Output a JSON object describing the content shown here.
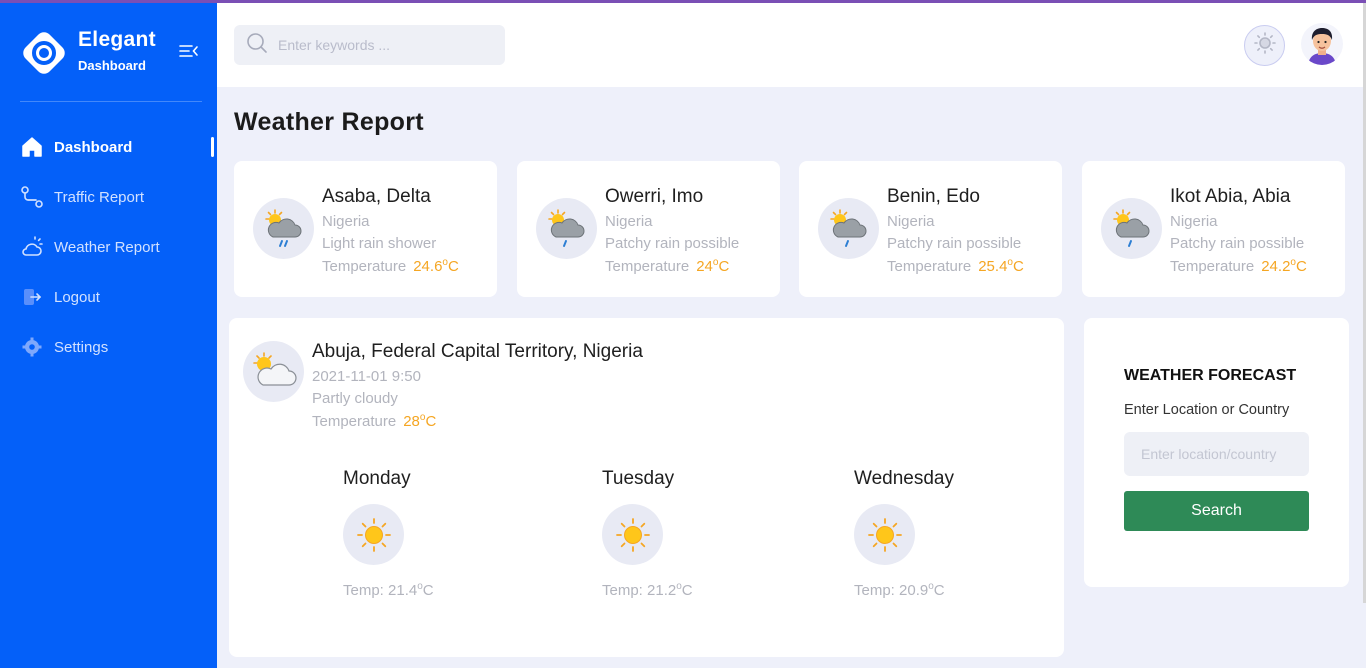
{
  "brand": {
    "name": "Elegant",
    "subtitle": "Dashboard"
  },
  "sidebar": {
    "items": [
      {
        "label": "Dashboard",
        "icon": "home-icon",
        "active": true
      },
      {
        "label": "Traffic Report",
        "icon": "route-icon",
        "active": false
      },
      {
        "label": "Weather Report",
        "icon": "weather-icon",
        "active": false
      },
      {
        "label": "Logout",
        "icon": "logout-icon",
        "active": false
      },
      {
        "label": "Settings",
        "icon": "settings-icon",
        "active": false
      }
    ]
  },
  "header": {
    "search_placeholder": "Enter keywords ..."
  },
  "page": {
    "title": "Weather Report"
  },
  "cities": [
    {
      "name": "Asaba, Delta",
      "country": "Nigeria",
      "condition": "Light rain shower",
      "temp_label": "Temperature",
      "temp": "24.6"
    },
    {
      "name": "Owerri, Imo",
      "country": "Nigeria",
      "condition": "Patchy rain possible",
      "temp_label": "Temperature",
      "temp": "24"
    },
    {
      "name": "Benin, Edo",
      "country": "Nigeria",
      "condition": "Patchy rain possible",
      "temp_label": "Temperature",
      "temp": "25.4"
    },
    {
      "name": "Ikot Abia, Abia",
      "country": "Nigeria",
      "condition": "Patchy rain possible",
      "temp_label": "Temperature",
      "temp": "24.2"
    }
  ],
  "current": {
    "location": "Abuja, Federal Capital Territory, Nigeria",
    "datetime": "2021-11-01 9:50",
    "condition": "Partly cloudy",
    "temp_label": "Temperature",
    "temp": "28"
  },
  "forecast_days": [
    {
      "day": "Monday",
      "temp_prefix": "Temp: ",
      "temp": "21.4"
    },
    {
      "day": "Tuesday",
      "temp_prefix": "Temp: ",
      "temp": "21.2"
    },
    {
      "day": "Wednesday",
      "temp_prefix": "Temp: ",
      "temp": "20.9"
    }
  ],
  "forecast": {
    "title": "WEATHER FORECAST",
    "label": "Enter Location or Country",
    "placeholder": "Enter location/country",
    "button": "Search"
  },
  "units": {
    "degree": "o",
    "celsius": "C"
  },
  "colors": {
    "sidebar": "#0460f9",
    "accent_temp": "#f5a623",
    "button": "#2e8a57"
  }
}
